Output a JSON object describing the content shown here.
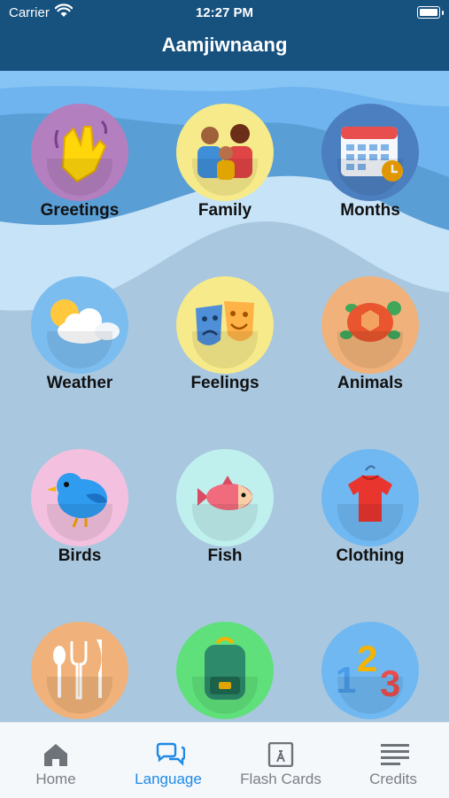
{
  "status_bar": {
    "carrier": "Carrier",
    "time": "12:27 PM"
  },
  "header": {
    "title": "Aamjiwnaang"
  },
  "categories": [
    {
      "label": "Greetings",
      "icon": "waving-hand-icon"
    },
    {
      "label": "Family",
      "icon": "family-icon"
    },
    {
      "label": "Months",
      "icon": "calendar-icon"
    },
    {
      "label": "Weather",
      "icon": "sun-cloud-icon"
    },
    {
      "label": "Feelings",
      "icon": "theater-masks-icon"
    },
    {
      "label": "Animals",
      "icon": "turtle-icon"
    },
    {
      "label": "Birds",
      "icon": "bird-icon"
    },
    {
      "label": "Fish",
      "icon": "fish-icon"
    },
    {
      "label": "Clothing",
      "icon": "shirt-icon"
    },
    {
      "label": "",
      "icon": "utensils-icon"
    },
    {
      "label": "",
      "icon": "backpack-icon"
    },
    {
      "label": "",
      "icon": "numbers-icon"
    }
  ],
  "tabs": [
    {
      "label": "Home",
      "icon": "home-icon",
      "active": false
    },
    {
      "label": "Language",
      "icon": "chat-bubbles-icon",
      "active": true
    },
    {
      "label": "Flash Cards",
      "icon": "flash-card-icon",
      "active": false
    },
    {
      "label": "Credits",
      "icon": "list-icon",
      "active": false
    }
  ],
  "colors": {
    "header": "#17527f",
    "active_tab": "#1e88e5",
    "inactive_tab": "#7b7f84"
  }
}
